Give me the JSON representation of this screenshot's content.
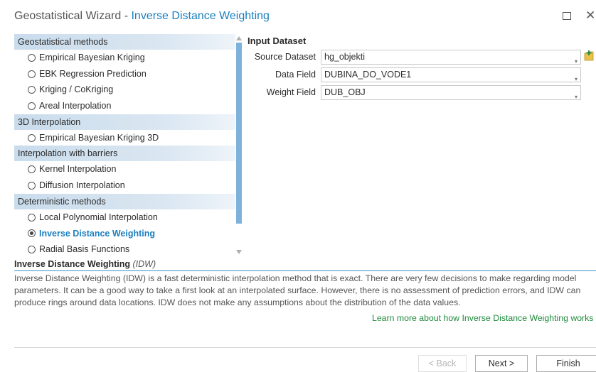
{
  "window": {
    "app_title": "Geostatistical Wizard",
    "separator": " - ",
    "subtitle": "Inverse Distance Weighting",
    "maximize_icon": "maximize-icon",
    "close_icon": "close-icon"
  },
  "methods": {
    "categories": [
      {
        "label": "Geostatistical methods",
        "items": [
          {
            "label": "Empirical Bayesian Kriging",
            "selected": false
          },
          {
            "label": "EBK Regression Prediction",
            "selected": false
          },
          {
            "label": "Kriging / CoKriging",
            "selected": false
          },
          {
            "label": "Areal Interpolation",
            "selected": false
          }
        ]
      },
      {
        "label": "3D Interpolation",
        "items": [
          {
            "label": "Empirical Bayesian Kriging 3D",
            "selected": false
          }
        ]
      },
      {
        "label": "Interpolation with barriers",
        "items": [
          {
            "label": "Kernel Interpolation",
            "selected": false
          },
          {
            "label": "Diffusion Interpolation",
            "selected": false
          }
        ]
      },
      {
        "label": "Deterministic methods",
        "items": [
          {
            "label": "Local Polynomial Interpolation",
            "selected": false
          },
          {
            "label": "Inverse Distance Weighting",
            "selected": true
          },
          {
            "label": "Radial Basis Functions",
            "selected": false
          }
        ]
      }
    ]
  },
  "input": {
    "title": "Input Dataset",
    "source_label": "Source Dataset",
    "source_value": "hg_objekti",
    "data_label": "Data Field",
    "data_value": "DUBINA_DO_VODE1",
    "weight_label": "Weight Field",
    "weight_value": "DUB_OBJ"
  },
  "description": {
    "title": "Inverse Distance Weighting",
    "abbr": "(IDW)",
    "lines": [
      "Inverse Distance Weighting (IDW) is a fast deterministic interpolation method that is exact. There are very few decisions to make regarding model",
      "parameters. It can be a good way to take a first look at an interpolated surface. However, there is no assessment of prediction errors, and IDW can",
      "produce rings around data locations. IDW does not make any assumptions about the distribution of the data values."
    ],
    "learn_more": "Learn more about how Inverse Distance Weighting works"
  },
  "footer": {
    "back_label": "< Back",
    "next_label": "Next >",
    "finish_label": "Finish"
  },
  "colors": {
    "accent": "#1b7fbf",
    "category_bg": "#cfe0ee",
    "scroll_thumb": "#7fb2da",
    "link": "#1e8a3c"
  }
}
